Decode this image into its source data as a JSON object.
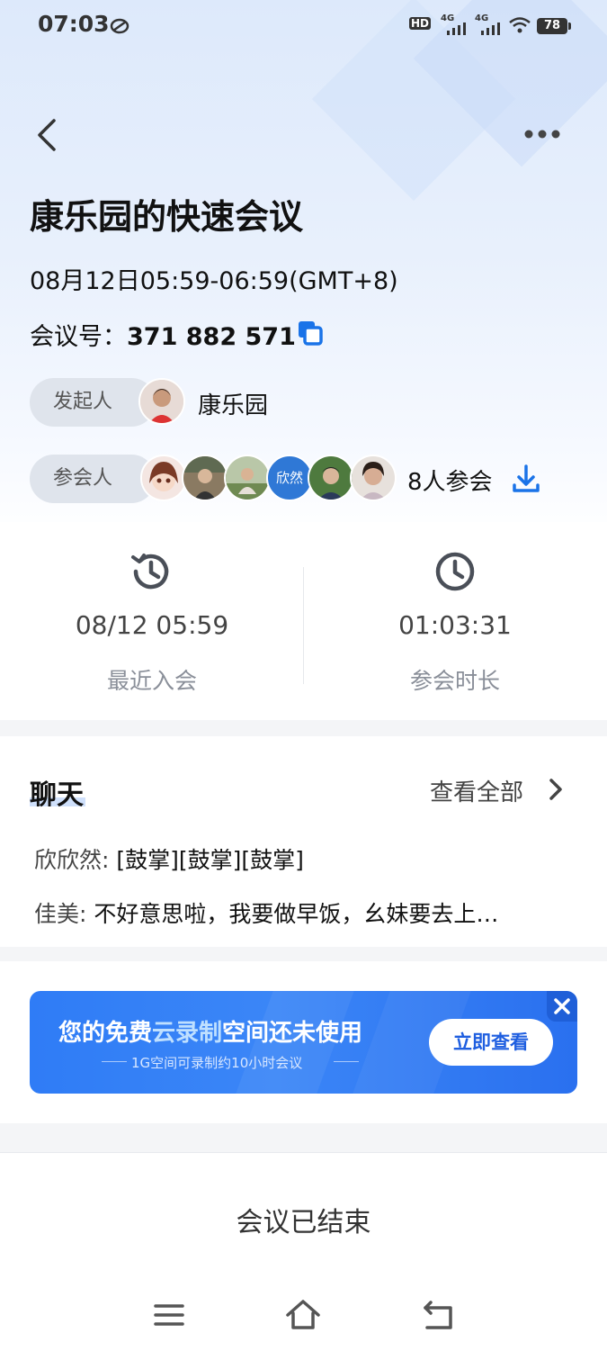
{
  "status_bar": {
    "time": "07:03",
    "hd": "HD",
    "net1": "4G",
    "net2": "4G",
    "battery": "78"
  },
  "header": {
    "title": "康乐园的快速会议",
    "datetime": "08月12日05:59-06:59(GMT+8)",
    "meeting_id_label": "会议号：",
    "meeting_id": "371 882 571"
  },
  "host": {
    "label": "发起人",
    "name": "康乐园"
  },
  "participants": {
    "label": "参会人",
    "text_avatar": "欣然",
    "count": "8人参会"
  },
  "stats": {
    "recent_join_value": "08/12 05:59",
    "recent_join_label": "最近入会",
    "duration_value": "01:03:31",
    "duration_label": "参会时长"
  },
  "chat": {
    "title": "聊天",
    "view_all": "查看全部",
    "messages": [
      {
        "sender": "欣欣然:",
        "text": "[鼓掌][鼓掌][鼓掌]"
      },
      {
        "sender": "佳美:",
        "text": "不好意思啦，我要做早饭，幺妹要去上…"
      }
    ]
  },
  "banner": {
    "title_a": "您的免费",
    "title_b": "云录制",
    "title_c": "空间还未使用",
    "subtitle": "1G空间可录制约10小时会议",
    "button": "立即查看"
  },
  "footer": {
    "status": "会议已结束"
  },
  "colors": {
    "accent": "#1a73e8",
    "banner": "#2f7cf6"
  }
}
